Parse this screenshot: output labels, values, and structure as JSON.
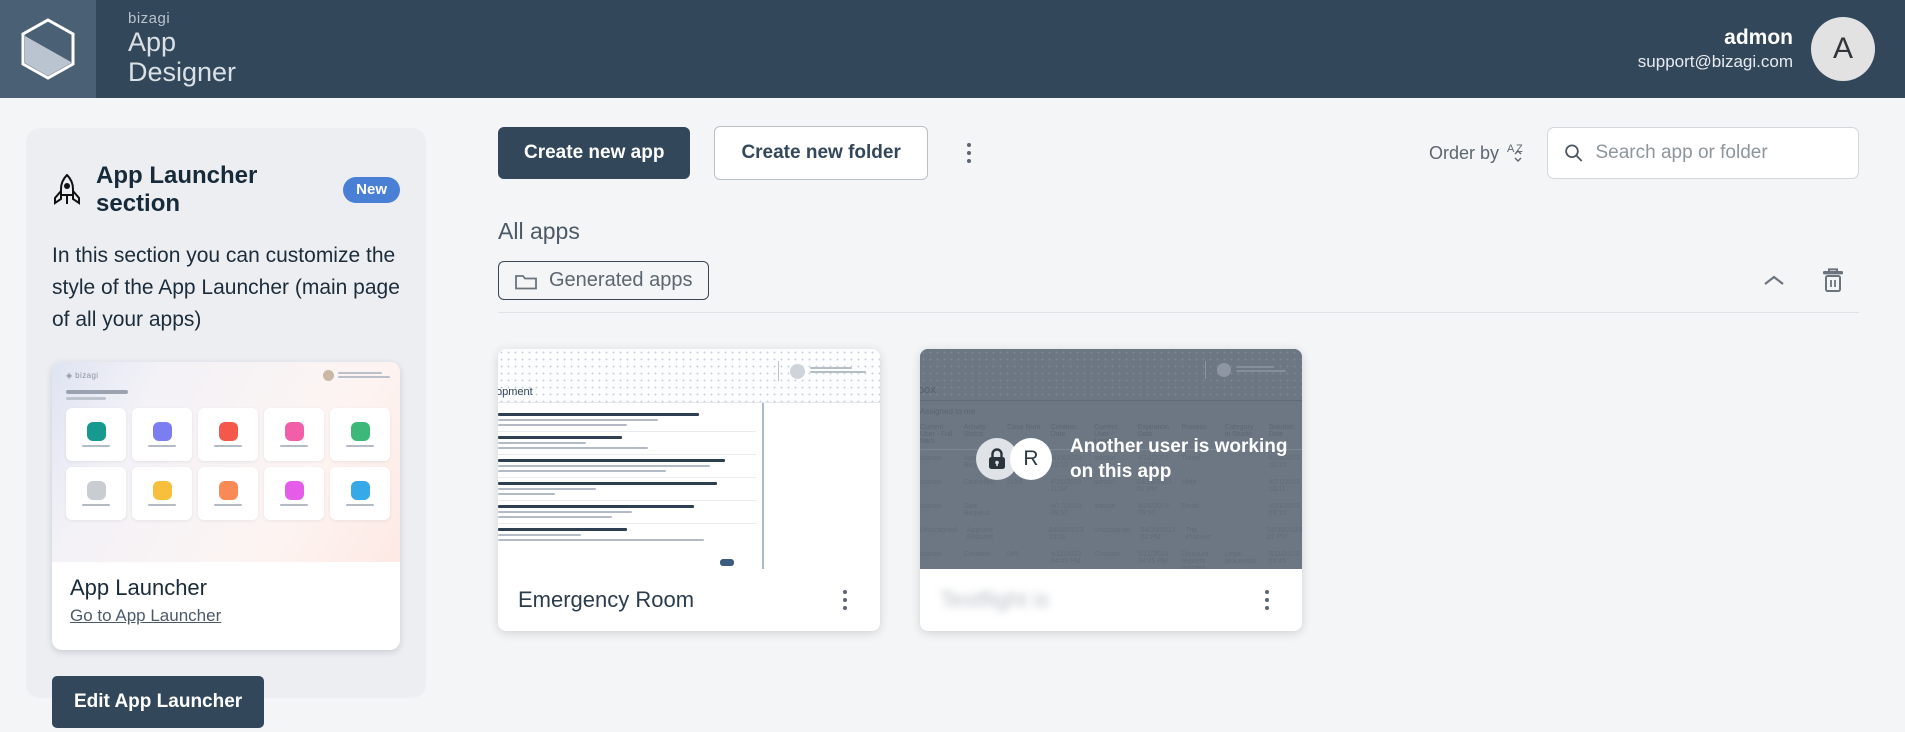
{
  "header": {
    "logo_icon": "bizagi-hex-logo",
    "brand_small": "bizagi",
    "brand_line1": "App",
    "brand_line2": "Designer",
    "user_name": "admon",
    "user_email": "support@bizagi.com",
    "avatar_initial": "A",
    "bg_color": "#33475b",
    "logo_panel_color": "#4a6075"
  },
  "sidebar": {
    "title": "App Launcher section",
    "title_icon": "rocket-icon",
    "badge": "New",
    "badge_color": "#4a7fd6",
    "description": "In this section you can customize the style of the App Launcher (main page of all your apps)",
    "preview": {
      "card_title": "App Launcher",
      "link_label": "Go to App Launcher",
      "tile_colors": [
        "#16998e",
        "#7b7ef0",
        "#f4584a",
        "#f25fa8",
        "#3cb878",
        "#c9cdd2",
        "#f7bf3c",
        "#fa8a55",
        "#e55ce8",
        "#36a9e8"
      ]
    },
    "edit_button": "Edit App Launcher",
    "edit_button_color": "#33475b"
  },
  "toolbar": {
    "create_app_label": "Create new app",
    "create_folder_label": "Create new folder",
    "more_icon": "kebab-menu-icon",
    "order_by_label": "Order by",
    "order_by_icon": "sort-az-icon",
    "search_icon": "search-icon",
    "search_placeholder": "Search app or folder",
    "search_value": ""
  },
  "content": {
    "section_title": "All apps",
    "folder_chip": {
      "label": "Generated apps",
      "icon": "folder-icon"
    },
    "collapse_icon": "chevron-up-icon",
    "delete_icon": "trash-icon",
    "apps": [
      {
        "title": "Emergency Room",
        "locked": false,
        "menu_icon": "kebab-menu-icon",
        "thumb_word": "opment"
      },
      {
        "title": "Testflight is",
        "locked": true,
        "menu_icon": "kebab-menu-icon",
        "thumb_word": "box",
        "lock_icon": "lock-icon",
        "lock_avatar_initial": "R",
        "lock_message_line1": "Another user is working",
        "lock_message_line2": "on this app",
        "table_headers": [
          "Current User - Full Nam",
          "Activity Status",
          "Case Num",
          "Creation Date",
          "Current User - Location",
          "Expiration Date",
          "Process",
          "Category in Studio",
          "Solution Date"
        ],
        "table_subtitle": "Assigned to me"
      }
    ]
  }
}
